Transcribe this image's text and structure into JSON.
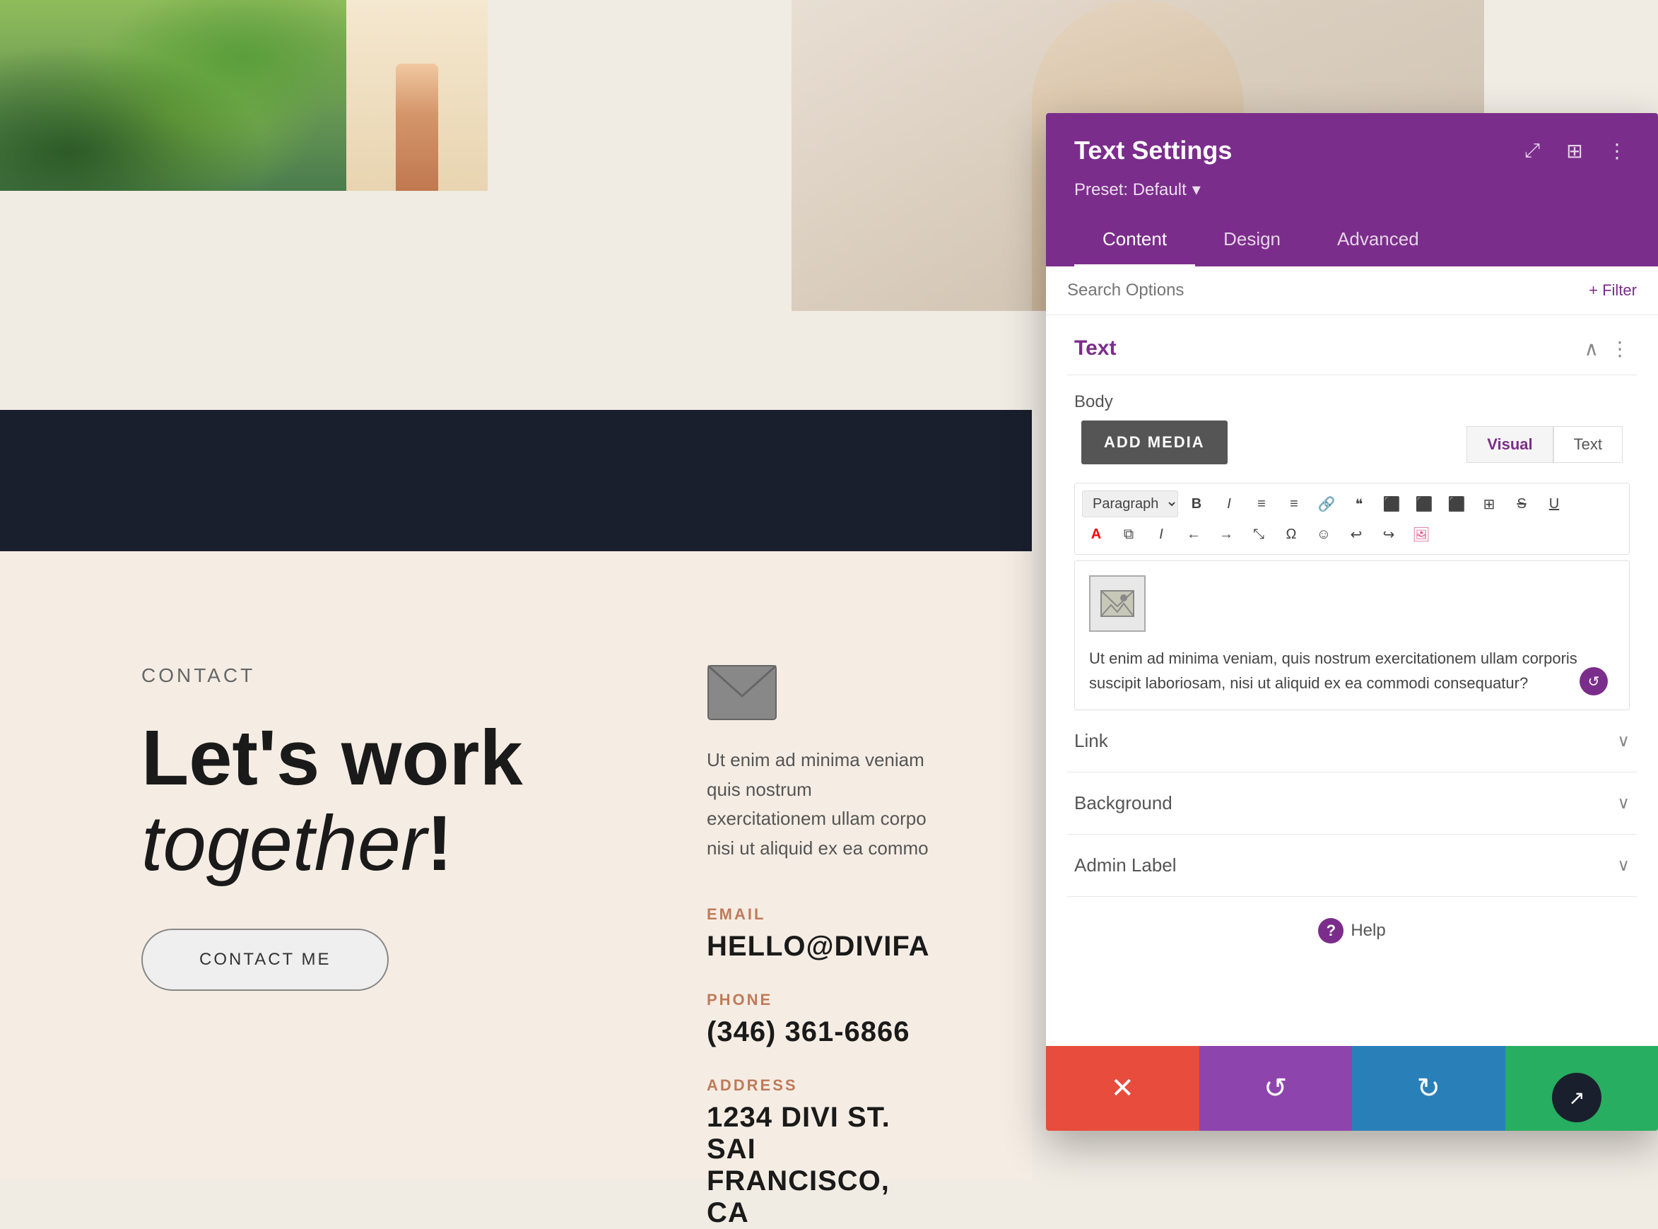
{
  "page": {
    "background_color": "#f0ebe3"
  },
  "top_images": {
    "plant_alt": "tropical plant image",
    "fashion_alt": "fashion photo",
    "portrait_alt": "woman portrait"
  },
  "contact_section": {
    "label": "CONTACT",
    "heading_line1": "Let's work",
    "heading_line2": "together",
    "heading_punctuation": "!",
    "button_text": "CONTACT ME",
    "envelope_alt": "envelope icon",
    "body_text": "Ut enim ad minima veniam quis nostrum exercitationem ullam corpo nisi ut aliquid ex ea commo",
    "email_label": "EMAIL",
    "email_value": "HELLO@DIVIFA",
    "phone_label": "PHONE",
    "phone_value": "(346) 361-6866",
    "address_label": "ADDRESS",
    "address_line1": "1234 DIVI ST. SAI",
    "address_line2": "FRANCISCO, CA"
  },
  "settings_panel": {
    "title": "Text Settings",
    "preset_label": "Preset: Default",
    "preset_arrow": "▾",
    "icon_expand": "⤢",
    "icon_layout": "⊞",
    "icon_more": "⋮",
    "tabs": [
      {
        "id": "content",
        "label": "Content",
        "active": true
      },
      {
        "id": "design",
        "label": "Design",
        "active": false
      },
      {
        "id": "advanced",
        "label": "Advanced",
        "active": false
      }
    ],
    "search_placeholder": "Search Options",
    "filter_button": "+ Filter",
    "text_section": {
      "title": "Text",
      "chevron_up": "∧",
      "more_icon": "⋮"
    },
    "body_label": "Body",
    "add_media_button": "ADD MEDIA",
    "editor_tabs": [
      {
        "label": "Visual",
        "active": true
      },
      {
        "label": "Text",
        "active": false
      }
    ],
    "toolbar": {
      "paragraph_select": "Paragraph",
      "buttons": [
        "B",
        "I",
        "≡",
        "≡",
        "🔗",
        "❝",
        "≡",
        "≡",
        "≡",
        "⊞",
        "S̶",
        "U̲",
        "A",
        "⧉",
        "I",
        "←",
        "→",
        "⤡",
        "Ω",
        "☺",
        "↩",
        "↪",
        "🖼"
      ]
    },
    "editor_content": {
      "image_placeholder": "✉",
      "body_text": "Ut enim ad minima veniam, quis nostrum exercitationem ullam corporis suscipit laboriosam, nisi ut aliquid ex ea commodi consequatur?"
    },
    "collapsible_sections": [
      {
        "label": "Link"
      },
      {
        "label": "Background"
      },
      {
        "label": "Admin Label"
      }
    ],
    "help": {
      "icon": "?",
      "text": "Help"
    },
    "footer": {
      "cancel_icon": "✕",
      "undo_icon": "↺",
      "redo_icon": "↻",
      "save_icon": "✓"
    }
  },
  "bottom_icon": {
    "symbol": "↗"
  }
}
